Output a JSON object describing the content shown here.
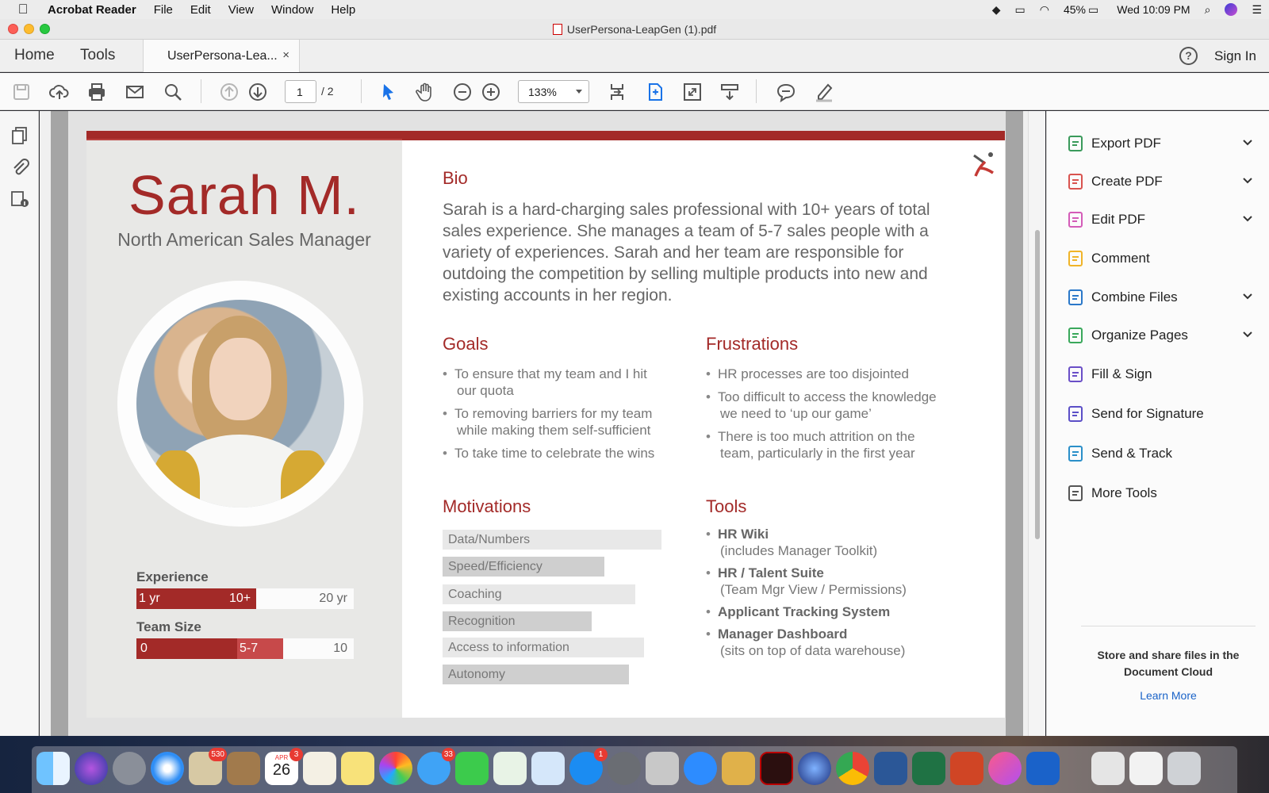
{
  "menubar": {
    "app_name": "Acrobat Reader",
    "items": [
      "File",
      "Edit",
      "View",
      "Window",
      "Help"
    ],
    "battery": "45%",
    "clock": "Wed 10:09 PM"
  },
  "window": {
    "title": "UserPersona-LeapGen (1).pdf"
  },
  "tabs": {
    "home": "Home",
    "tools": "Tools",
    "document": "UserPersona-Lea...",
    "close": "×",
    "sign_in": "Sign In",
    "help": "?"
  },
  "toolbar": {
    "current_page": "1",
    "total_pages": "/ 2",
    "zoom": "133%"
  },
  "persona": {
    "name": "Sarah M.",
    "role": "North American Sales Manager",
    "experience": {
      "label": "Experience",
      "start": "1 yr",
      "value_label": "10+",
      "end": "20 yr",
      "fraction": 0.5
    },
    "team_size": {
      "label": "Team Size",
      "start": "0",
      "value_label": "5-7",
      "end": "10",
      "fraction_low": 0.5,
      "fraction_high": 0.7
    },
    "bio_heading": "Bio",
    "bio": "Sarah is a hard-charging sales professional with 10+ years of total sales experience. She manages a team of 5-7 sales people with a variety of experiences. Sarah and her team are responsible for outdoing the competition by selling multiple products into new and existing accounts in her region.",
    "goals_heading": "Goals",
    "goals": [
      [
        "To ensure that my team and I hit",
        "our quota"
      ],
      [
        "To removing barriers for my team",
        "while making them self-sufficient"
      ],
      [
        "To take time to celebrate the wins",
        ""
      ]
    ],
    "frustrations_heading": "Frustrations",
    "frustrations": [
      [
        "HR processes are too disjointed",
        ""
      ],
      [
        "Too difficult to access the knowledge",
        "we need to ‘up our game’"
      ],
      [
        "There is too much attrition on the",
        "team, particularly in the first year"
      ]
    ],
    "motivations_heading": "Motivations",
    "motivations": [
      {
        "label": "Data/Numbers",
        "level": 1.0
      },
      {
        "label": "Speed/Efficiency",
        "level": 0.74
      },
      {
        "label": "Coaching",
        "level": 0.88
      },
      {
        "label": "Recognition",
        "level": 0.68
      },
      {
        "label": "Access to information",
        "level": 0.92
      },
      {
        "label": "Autonomy",
        "level": 0.85
      }
    ],
    "tools_heading": "Tools",
    "tools": [
      {
        "name": "HR Wiki",
        "note": "(includes Manager Toolkit)"
      },
      {
        "name": "HR / Talent Suite",
        "note": "(Team Mgr View / Permissions)"
      },
      {
        "name": "Applicant Tracking System",
        "note": ""
      },
      {
        "name": "Manager Dashboard",
        "note": "(sits on top of data warehouse)"
      }
    ]
  },
  "right_pane": {
    "tools": [
      {
        "label": "Export PDF",
        "icon": "export-pdf-icon",
        "color": "#3a9a5b",
        "expandable": true
      },
      {
        "label": "Create PDF",
        "icon": "create-pdf-icon",
        "color": "#d9534f",
        "expandable": true
      },
      {
        "label": "Edit PDF",
        "icon": "edit-pdf-icon",
        "color": "#d45cb8",
        "expandable": true
      },
      {
        "label": "Comment",
        "icon": "comment-icon",
        "color": "#f0b429",
        "expandable": false
      },
      {
        "label": "Combine Files",
        "icon": "combine-files-icon",
        "color": "#2a78c9",
        "expandable": true
      },
      {
        "label": "Organize Pages",
        "icon": "organize-pages-icon",
        "color": "#3aa85b",
        "expandable": true
      },
      {
        "label": "Fill & Sign",
        "icon": "fill-sign-icon",
        "color": "#6a4fc7",
        "expandable": false
      },
      {
        "label": "Send for Signature",
        "icon": "send-signature-icon",
        "color": "#5b4fc7",
        "expandable": false
      },
      {
        "label": "Send & Track",
        "icon": "send-track-icon",
        "color": "#2a8fc9",
        "expandable": false
      },
      {
        "label": "More Tools",
        "icon": "more-tools-icon",
        "color": "#555555",
        "expandable": false
      }
    ],
    "promo": "Store and share files in the Document Cloud",
    "learn_more": "Learn More"
  },
  "dock": {
    "badges": {
      "mail": "530",
      "calendar_badge": "3",
      "messages": "33",
      "app_store": "1"
    },
    "calendar_day": "26",
    "calendar_month": "APR"
  }
}
